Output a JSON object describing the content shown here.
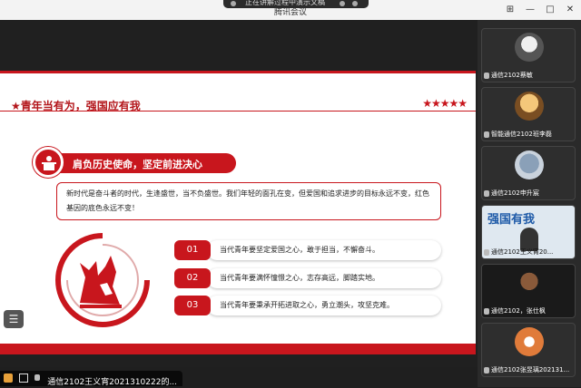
{
  "window": {
    "title": "腾讯会议",
    "share_text": "正在讲解过程中演示文稿",
    "controls": {
      "pin": "⊞",
      "minimize": "—",
      "maximize": "□",
      "close": "✕"
    }
  },
  "slide": {
    "title": "★青年当有为，强国应有我",
    "stars": "★★★★★",
    "section_title": "肩负历史使命，坚定前进决心",
    "paragraph": "新时代是奋斗者的时代，生逢盛世，当不负盛世。我们年轻的面孔在变，但爱国和追求进步的目标永远不变，红色基因的底色永远不变！",
    "points": [
      {
        "num": "01",
        "text": "当代青年要坚定爱国之心，敢于担当，不懈奋斗。"
      },
      {
        "num": "02",
        "text": "当代青年要满怀憧憬之心，志存高远，脚踏实地。"
      },
      {
        "num": "03",
        "text": "当代青年要秉承开拓进取之心，勇立潮头，攻坚克难。"
      }
    ],
    "colors": {
      "accent": "#c8161d"
    }
  },
  "speaker": {
    "name": "通信2102王义宵2021310222的..."
  },
  "participants": [
    {
      "name": "通信2102蔡敏"
    },
    {
      "name": "智能通信2102班李磊"
    },
    {
      "name": "通信2102申升宸"
    },
    {
      "name": "通信2102王义宵20...",
      "banner": "强国有我"
    },
    {
      "name": "通信2102，张仕枫"
    },
    {
      "name": "通信2102张昱璃202131..."
    }
  ]
}
